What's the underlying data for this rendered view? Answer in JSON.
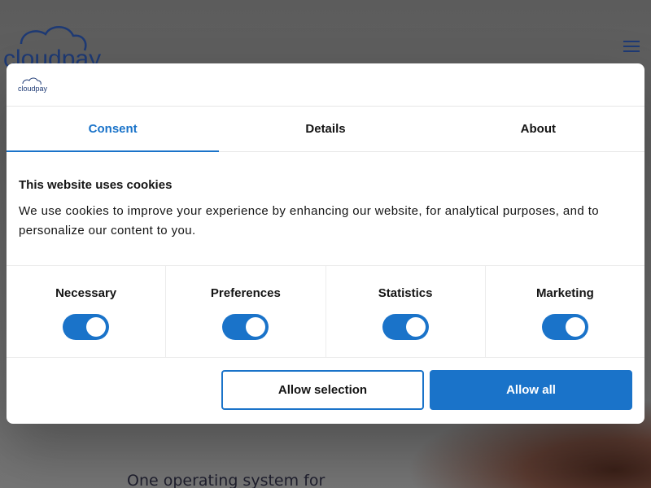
{
  "background": {
    "brand": "cloudpay",
    "hero_text": "One operating system for",
    "menu_icon": "hamburger-menu-icon"
  },
  "dialog": {
    "brand": "cloudpay",
    "tabs": [
      {
        "label": "Consent",
        "active": true
      },
      {
        "label": "Details",
        "active": false
      },
      {
        "label": "About",
        "active": false
      }
    ],
    "heading": "This website uses cookies",
    "description": "We use cookies to improve your experience by enhancing our website, for analytical purposes, and to personalize our content to you.",
    "toggles": [
      {
        "label": "Necessary",
        "on": true
      },
      {
        "label": "Preferences",
        "on": true
      },
      {
        "label": "Statistics",
        "on": true
      },
      {
        "label": "Marketing",
        "on": true
      }
    ],
    "buttons": {
      "allow_selection": "Allow selection",
      "allow_all": "Allow all"
    }
  },
  "colors": {
    "accent": "#1a73c9",
    "brand_navy": "#1e3a75",
    "overlay": "#6f6f6f"
  }
}
